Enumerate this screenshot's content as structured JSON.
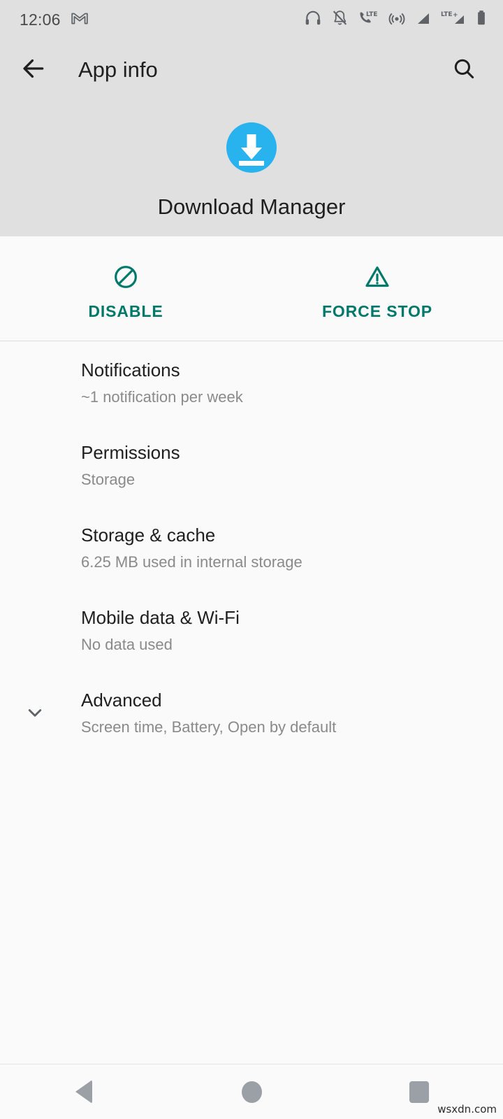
{
  "status_bar": {
    "time": "12:06",
    "notification_icons": [
      "gmail-icon"
    ],
    "system_icons": [
      "headset-icon",
      "notifications-off-icon",
      "lte-call-icon",
      "hotspot-icon",
      "signal-bars-icon",
      "lte-plus-signal-icon",
      "battery-icon"
    ]
  },
  "app_bar": {
    "back_icon": "back-arrow-icon",
    "title": "App info",
    "search_icon": "search-icon"
  },
  "app_header": {
    "icon_name": "download-manager-icon",
    "icon_color": "#29B3EE",
    "app_name": "Download Manager"
  },
  "actions": {
    "accent_color": "#00796B",
    "buttons": [
      {
        "label": "DISABLE",
        "icon": "disable-circle-slash-icon"
      },
      {
        "label": "FORCE STOP",
        "icon": "warning-triangle-icon"
      }
    ]
  },
  "settings": {
    "items": [
      {
        "title": "Notifications",
        "subtitle": "~1 notification per week",
        "expandable": false
      },
      {
        "title": "Permissions",
        "subtitle": "Storage",
        "expandable": false
      },
      {
        "title": "Storage & cache",
        "subtitle": "6.25 MB used in internal storage",
        "expandable": false
      },
      {
        "title": "Mobile data & Wi-Fi",
        "subtitle": "No data used",
        "expandable": false
      },
      {
        "title": "Advanced",
        "subtitle": "Screen time, Battery, Open by default",
        "expandable": true,
        "expand_icon": "chevron-down-icon"
      }
    ]
  },
  "nav_bar": {
    "back_label": "Back",
    "home_label": "Home",
    "recents_label": "Recents"
  },
  "watermark": {
    "text": "wsxdn.com"
  }
}
